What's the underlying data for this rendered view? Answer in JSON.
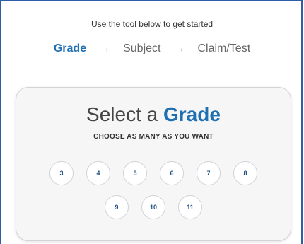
{
  "intro": "Use the tool below to get started",
  "steps": [
    {
      "label": "Grade"
    },
    {
      "label": "Subject"
    },
    {
      "label": "Claim/Test"
    }
  ],
  "arrow_glyph": "→",
  "card": {
    "title_prefix": "Select a",
    "title_emphasis": "Grade",
    "subtitle": "CHOOSE AS MANY AS YOU WANT",
    "grades_row1": [
      "3",
      "4",
      "5",
      "6",
      "7",
      "8"
    ],
    "grades_row2": [
      "9",
      "10",
      "11"
    ]
  },
  "colors": {
    "accent": "#1f6fb3",
    "frame": "#2f5ea8",
    "card_bg": "#f6f6f6"
  }
}
